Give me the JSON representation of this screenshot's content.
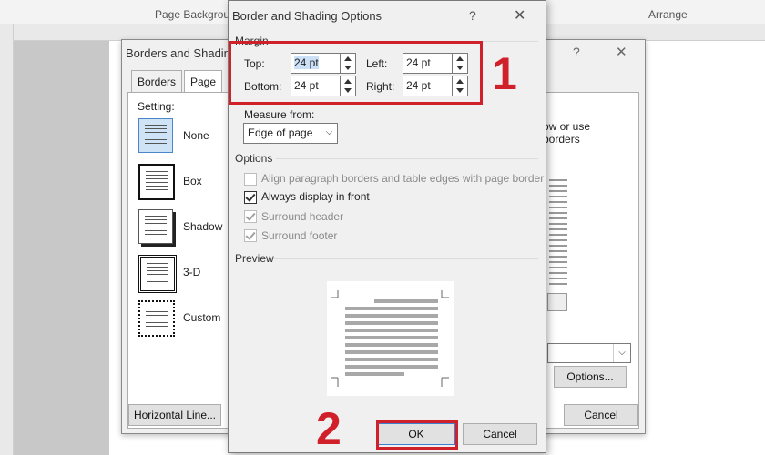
{
  "ribbon": {
    "group_left": "Page Backgrou",
    "group_right": "Arrange"
  },
  "back_dialog": {
    "title": "Borders and Shadin",
    "help": "?",
    "close": "✕",
    "tabs": [
      "Borders",
      "Page Bo"
    ],
    "setting_label": "Setting:",
    "settings": [
      "None",
      "Box",
      "Shadow",
      "3-D",
      "Custom"
    ],
    "side_text_1": "ow or use",
    "side_text_2": "borders",
    "options_button": "Options...",
    "horizontal_line_button": "Horizontal Line...",
    "cancel_button": "Cancel"
  },
  "dialog": {
    "title": "Border and Shading Options",
    "help": "?",
    "close": "✕",
    "margin_group": "Margin",
    "top_label": "Top:",
    "top_value": "24 pt",
    "left_label": "Left:",
    "left_value": "24 pt",
    "bottom_label": "Bottom:",
    "bottom_value": "24 pt",
    "right_label": "Right:",
    "right_value": "24 pt",
    "measure_label": "Measure from:",
    "measure_value": "Edge of page",
    "options_group": "Options",
    "opt_align": "Align paragraph borders and table edges with page border",
    "opt_front": "Always display in front",
    "opt_header": "Surround header",
    "opt_footer": "Surround footer",
    "preview_label": "Preview",
    "ok_button": "OK",
    "cancel_button": "Cancel"
  },
  "annotations": {
    "step1": "1",
    "step2": "2",
    "color": "#d0202a"
  }
}
